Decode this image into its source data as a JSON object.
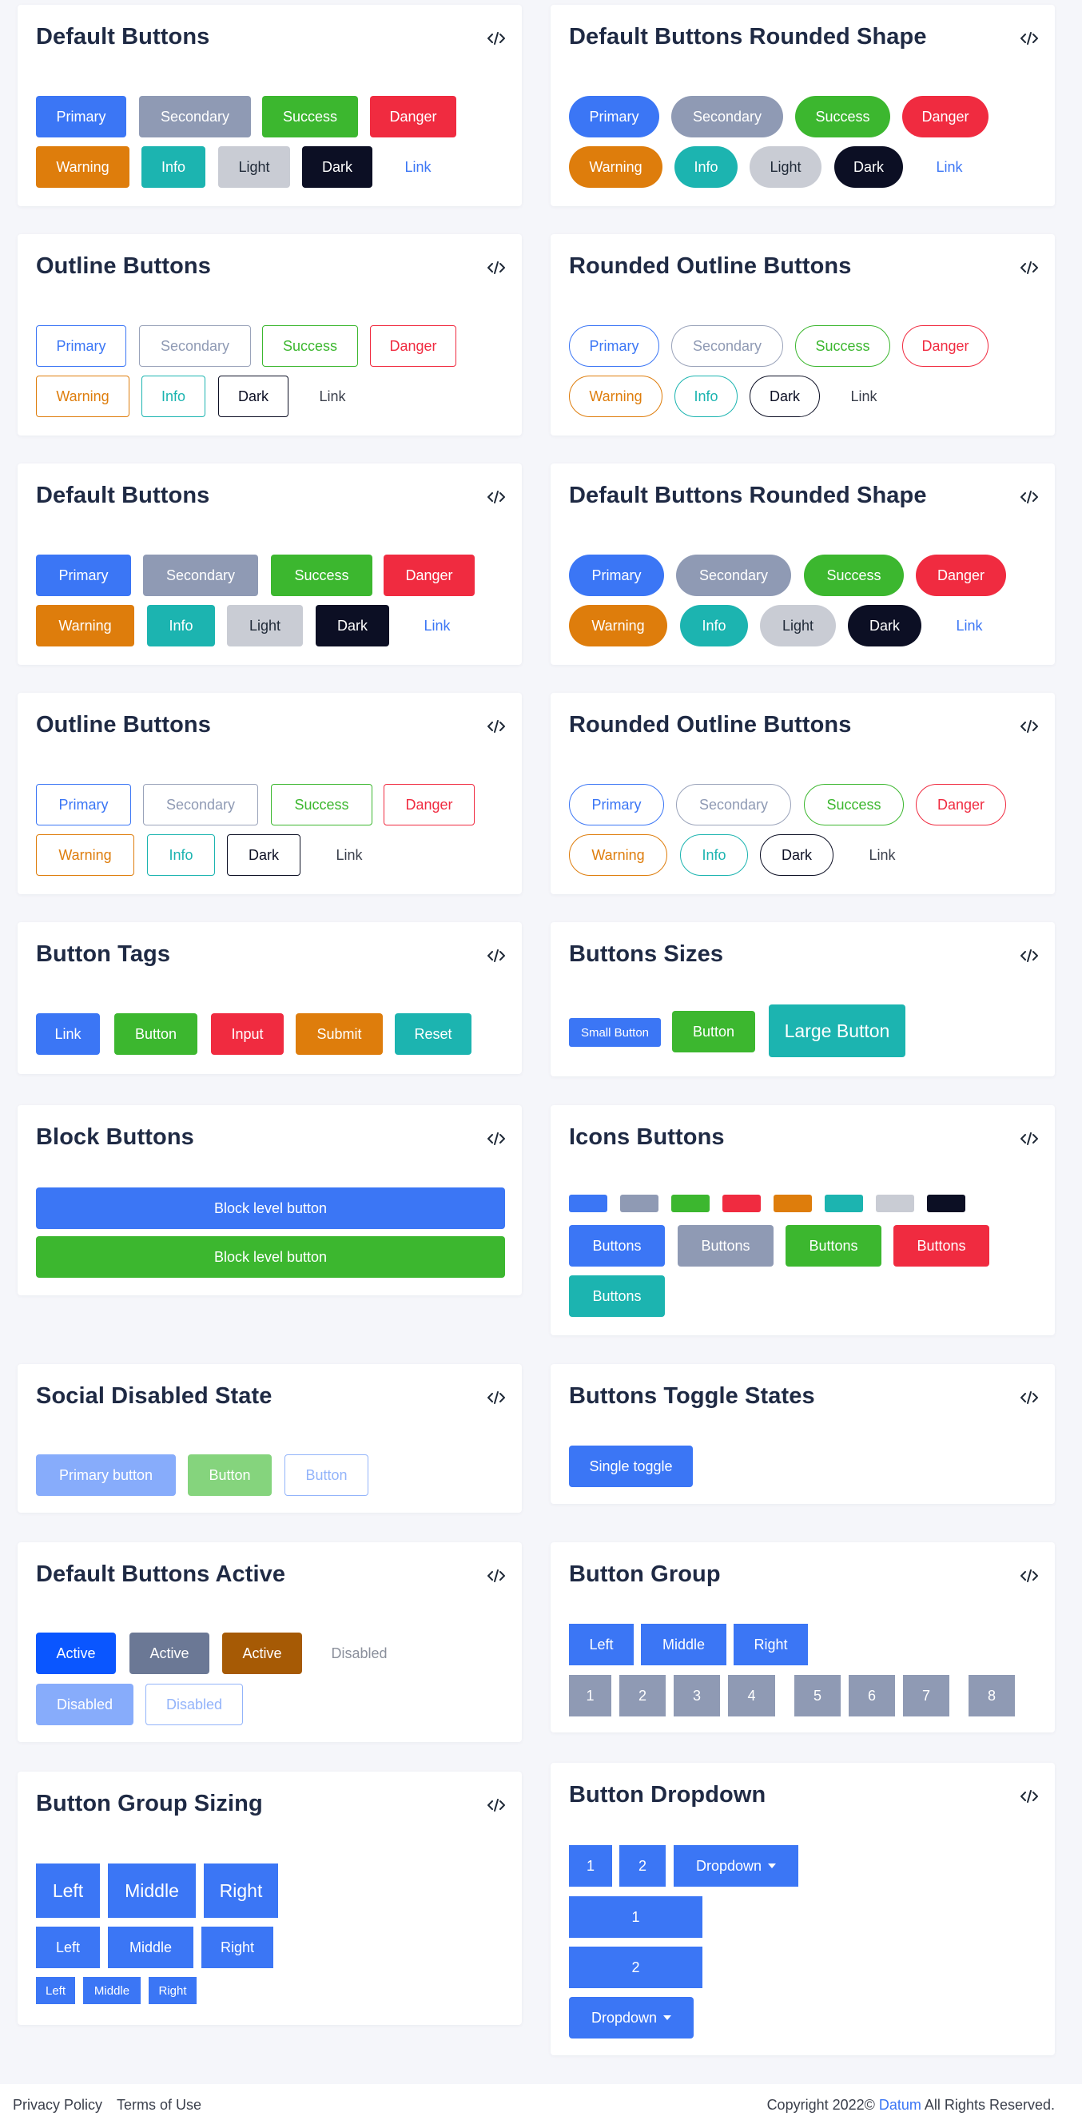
{
  "code_icon": "code-icon",
  "labels": {
    "primary": "Primary",
    "secondary": "Secondary",
    "success": "Success",
    "danger": "Danger",
    "warning": "Warning",
    "info": "Info",
    "light": "Light",
    "dark": "Dark",
    "link": "Link"
  },
  "cards": {
    "default": "Default Buttons",
    "default_rounded": "Default Buttons Rounded Shape",
    "outline": "Outline Buttons",
    "rounded_outline": "Rounded Outline Buttons",
    "tags": "Button Tags",
    "sizes": "Buttons Sizes",
    "block": "Block Buttons",
    "icons": "Icons Buttons",
    "social_disabled": "Social Disabled State",
    "toggle": "Buttons Toggle States",
    "active": "Default Buttons Active",
    "group": "Button Group",
    "group_sizing": "Button Group Sizing",
    "dropdown": "Button Dropdown"
  },
  "tags": {
    "link": "Link",
    "button": "Button",
    "input": "Input",
    "submit": "Submit",
    "reset": "Reset"
  },
  "sizes": {
    "small": "Small Button",
    "normal": "Button",
    "large": "Large Button"
  },
  "block": {
    "label": "Block level button"
  },
  "icons": {
    "label": "Buttons"
  },
  "social_disabled": {
    "primary": "Primary button",
    "button": "Button",
    "outline": "Button"
  },
  "toggle": {
    "label": "Single toggle"
  },
  "active": {
    "active": "Active",
    "disabled": "Disabled"
  },
  "group": {
    "left": "Left",
    "middle": "Middle",
    "right": "Right",
    "numbers": [
      "1",
      "2",
      "3",
      "4",
      "5",
      "6",
      "7",
      "8"
    ]
  },
  "group_sizing": {
    "left": "Left",
    "middle": "Middle",
    "right": "Right"
  },
  "dropdown": {
    "one": "1",
    "two": "2",
    "dropdown": "Dropdown"
  },
  "footer": {
    "privacy": "Privacy Policy",
    "terms": "Terms of Use",
    "copyright_prefix": "Copyright 2022© ",
    "brand": "Datum",
    "copyright_suffix": " All Rights Reserved."
  },
  "colors": {
    "primary": "#3b76f5",
    "secondary": "#8f9ab4",
    "success": "#3cb72f",
    "danger": "#f02b40",
    "warning": "#de7d0c",
    "info": "#1cb4b0",
    "light": "#c9ccd4",
    "dark": "#0c0f24"
  }
}
